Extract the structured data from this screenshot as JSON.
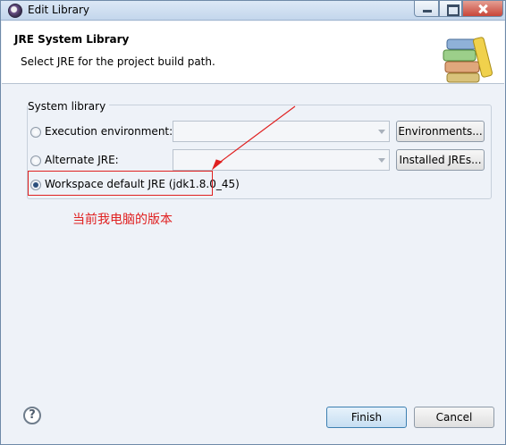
{
  "window": {
    "title": "Edit Library",
    "minimize_icon": "minimize-icon",
    "maximize_icon": "maximize-icon",
    "close_icon": "close-icon"
  },
  "header": {
    "title": "JRE System Library",
    "description": "Select JRE for the project build path.",
    "icon": "library-books-icon"
  },
  "system_library": {
    "group_label": "System library",
    "options": [
      {
        "label": "Execution environment:",
        "selected": false,
        "enabled": true
      },
      {
        "label": "Alternate JRE:",
        "selected": false,
        "enabled": true
      },
      {
        "label": "Workspace default JRE (jdk1.8.0_45)",
        "selected": true,
        "enabled": true
      }
    ],
    "execution_env_value": "",
    "alternate_jre_value": "",
    "environments_button": "Environments...",
    "installed_jres_button": "Installed JREs..."
  },
  "annotation": {
    "text": "当前我电脑的版本",
    "color": "#e02020"
  },
  "footer": {
    "help_icon": "help-icon",
    "help_glyph": "?",
    "finish_button": "Finish",
    "cancel_button": "Cancel"
  }
}
